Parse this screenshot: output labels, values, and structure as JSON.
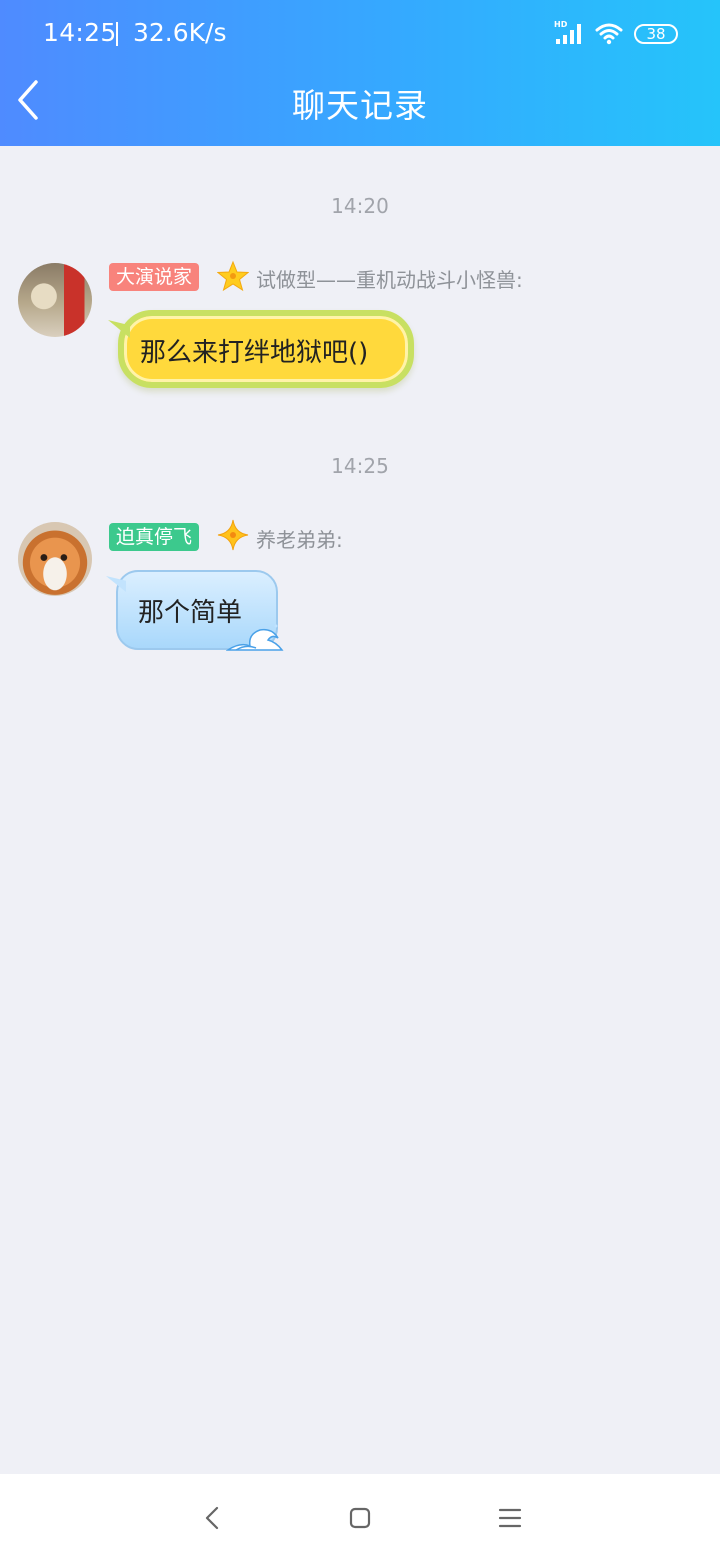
{
  "status_bar": {
    "time": "14:25",
    "speed": "32.6K/s",
    "battery": "38",
    "network": "HD"
  },
  "header": {
    "title": "聊天记录"
  },
  "messages": [
    {
      "timestamp": "14:20",
      "badge": "大演说家",
      "badge_color": "#f8837c",
      "level_icon": "star-icon",
      "sender": "试做型——重机动战斗小怪兽:",
      "text": "那么来打绊地狱吧()",
      "bubble_style": "lemon"
    },
    {
      "timestamp": "14:25",
      "badge": "迫真停飞",
      "badge_color": "#3cc98d",
      "level_icon": "sparkle-icon",
      "sender": "养老弟弟:",
      "text": "那个简单",
      "bubble_style": "wave"
    }
  ],
  "colors": {
    "header_gradient_start": "#4f8bff",
    "header_gradient_end": "#25c4fa",
    "background": "#eff0f6"
  },
  "nav_bar": {
    "icons": [
      "back-nav-icon",
      "home-nav-icon",
      "menu-nav-icon"
    ]
  }
}
